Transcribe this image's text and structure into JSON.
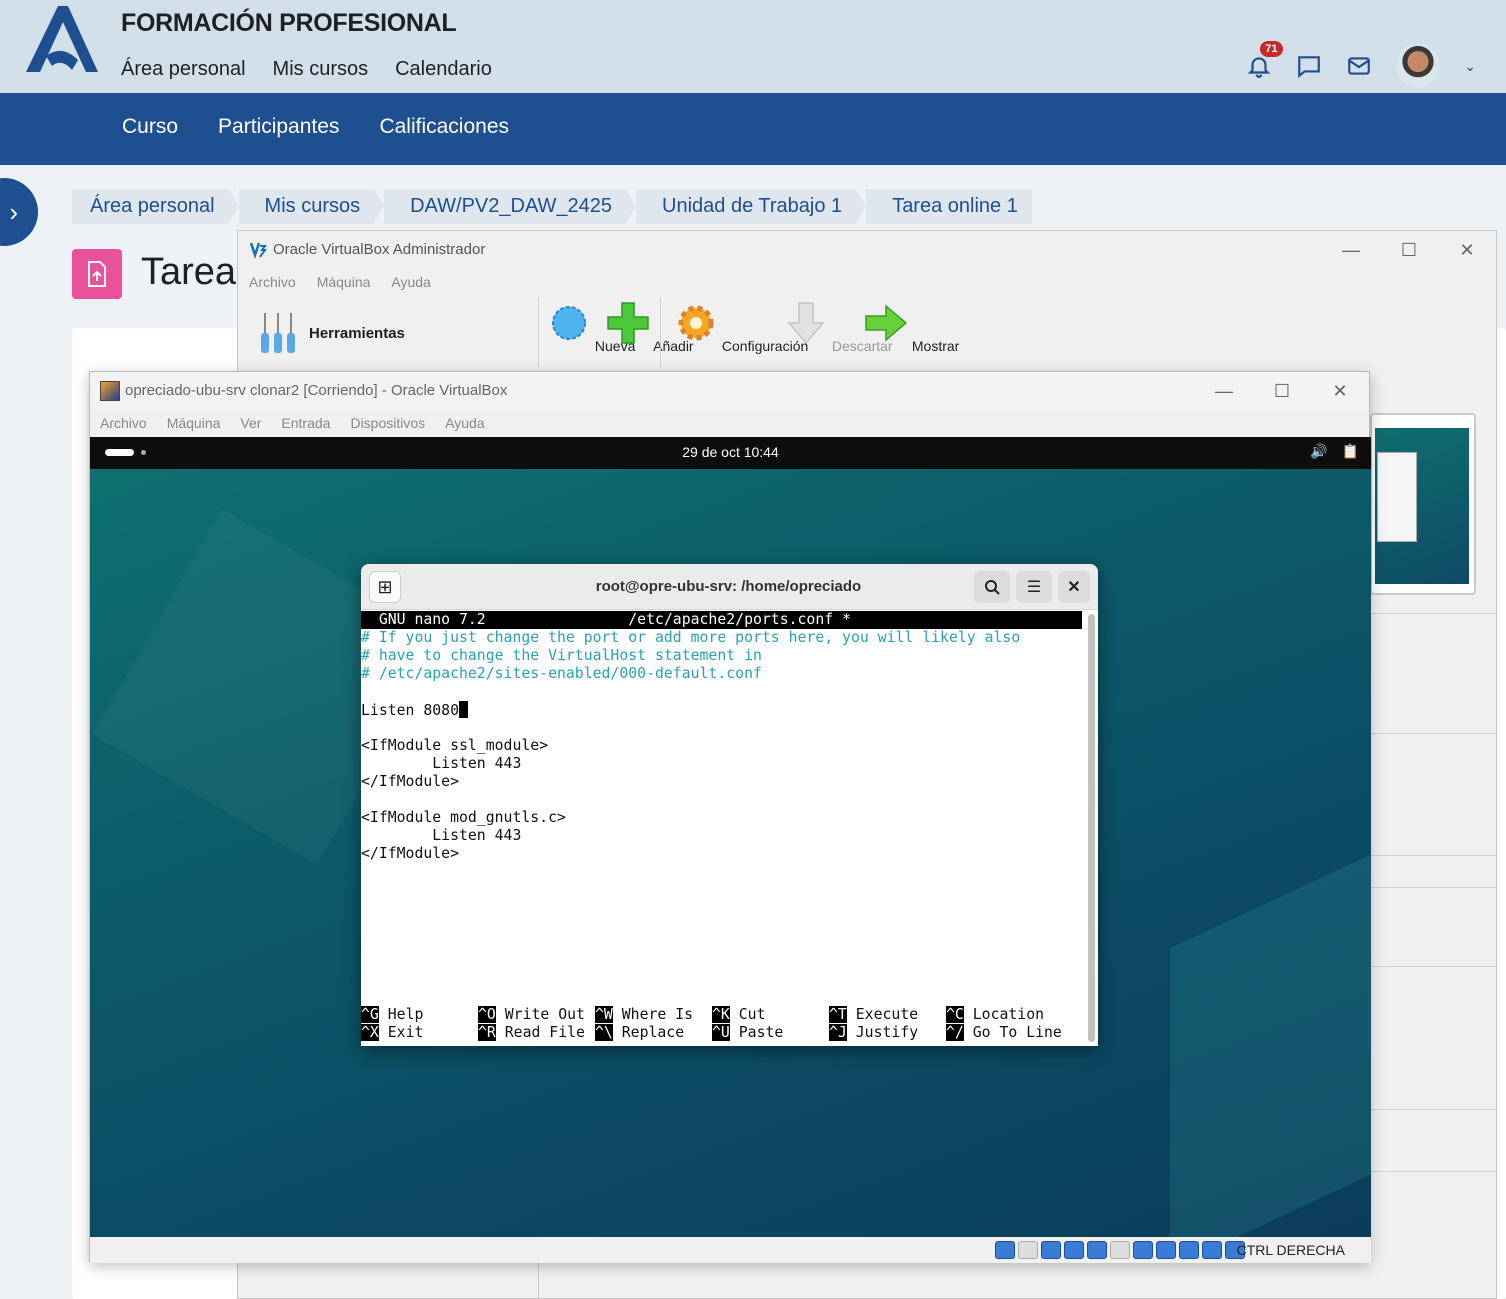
{
  "moodle": {
    "site_title": "FORMACIÓN PROFESIONAL",
    "primary_nav": [
      "Área personal",
      "Mis cursos",
      "Calendario"
    ],
    "notifications_count": "71",
    "secondary_nav": [
      "Curso",
      "Participantes",
      "Calificaciones"
    ],
    "breadcrumb": [
      "Área personal",
      "Mis cursos",
      "DAW/PV2_DAW_2425",
      "Unidad de Trabajo 1",
      "Tarea online 1"
    ],
    "page_title": "Tarea"
  },
  "vbox_manager": {
    "title": "Oracle VirtualBox Administrador",
    "menu": [
      "Archivo",
      "Máquina",
      "Ayuda"
    ],
    "tools_label": "Herramientas",
    "toolbar": [
      "Nueva",
      "Añadir",
      "Configuración",
      "Descartar",
      "Mostrar"
    ]
  },
  "vm_window": {
    "title": "opreciado-ubu-srv clonar2 [Corriendo] - Oracle VirtualBox",
    "menu": [
      "Archivo",
      "Máquina",
      "Ver",
      "Entrada",
      "Dispositivos",
      "Ayuda"
    ],
    "host_key": "CTRL DERECHA",
    "guest": {
      "clock": "29 de oct  10:44",
      "terminal": {
        "title": "root@opre-ubu-srv: /home/opreciado",
        "nano_header": "  GNU nano 7.2                /etc/apache2/ports.conf *",
        "lines": [
          "# If you just change the port or add more ports here, you will likely also",
          "# have to change the VirtualHost statement in",
          "# /etc/apache2/sites-enabled/000-default.conf",
          "",
          "Listen 8080",
          "",
          "<IfModule ssl_module>",
          "        Listen 443",
          "</IfModule>",
          "",
          "<IfModule mod_gnutls.c>",
          "        Listen 443",
          "</IfModule>"
        ],
        "shortcuts_row1": [
          {
            "key": "^G",
            "label": "Help"
          },
          {
            "key": "^O",
            "label": "Write Out"
          },
          {
            "key": "^W",
            "label": "Where Is"
          },
          {
            "key": "^K",
            "label": "Cut"
          },
          {
            "key": "^T",
            "label": "Execute"
          },
          {
            "key": "^C",
            "label": "Location"
          }
        ],
        "shortcuts_row2": [
          {
            "key": "^X",
            "label": "Exit"
          },
          {
            "key": "^R",
            "label": "Read File"
          },
          {
            "key": "^\\",
            "label": "Replace"
          },
          {
            "key": "^U",
            "label": "Paste"
          },
          {
            "key": "^J",
            "label": "Justify"
          },
          {
            "key": "^/",
            "label": "Go To Line"
          }
        ]
      }
    }
  }
}
